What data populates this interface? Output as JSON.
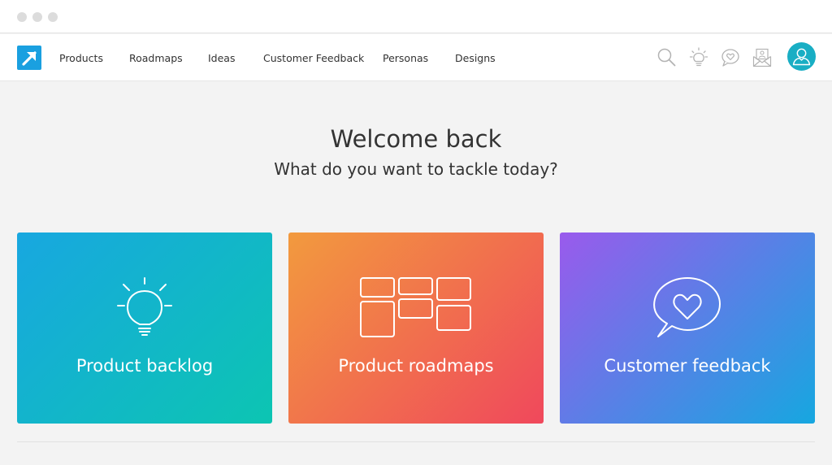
{
  "nav": {
    "items": [
      {
        "label": "Products"
      },
      {
        "label": "Roadmaps"
      },
      {
        "label": "Ideas"
      },
      {
        "label": "Customer Feedback"
      },
      {
        "label": "Personas"
      },
      {
        "label": "Designs"
      }
    ],
    "icons": [
      "search-icon",
      "lightbulb-icon",
      "chat-heart-icon",
      "inbox-icon",
      "user-avatar-icon"
    ]
  },
  "welcome": {
    "title": "Welcome back",
    "subtitle": "What do you want to tackle today?"
  },
  "cards": [
    {
      "label": "Product backlog",
      "icon": "lightbulb-icon"
    },
    {
      "label": "Product roadmaps",
      "icon": "roadmap-blocks-icon"
    },
    {
      "label": "Customer feedback",
      "icon": "chat-heart-icon"
    }
  ],
  "colors": {
    "accent": "#1aa0e0",
    "avatar": "#19aec4",
    "backlog_gradient": [
      "#18a7e0",
      "#0cc5b2"
    ],
    "roadmaps_gradient": [
      "#f29a3e",
      "#f0485c"
    ],
    "feedback_gradient": [
      "#9a5aec",
      "#16a7e0"
    ]
  }
}
